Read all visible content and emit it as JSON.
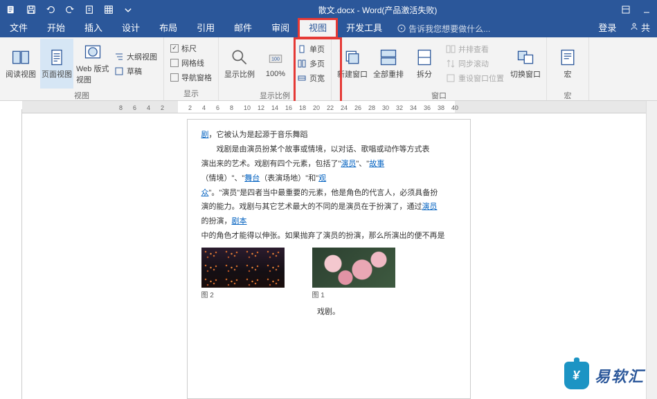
{
  "title": {
    "filename": "散文.docx",
    "app": "Word",
    "status": "(产品激活失败)"
  },
  "qat": {
    "save": "save",
    "undo": "undo",
    "redo": "redo",
    "new": "new-file",
    "table": "table"
  },
  "tabs": {
    "file": "文件",
    "home": "开始",
    "insert": "插入",
    "design": "设计",
    "layout": "布局",
    "references": "引用",
    "mailings": "邮件",
    "review": "审阅",
    "view": "视图",
    "developer": "开发工具",
    "tellme_placeholder": "告诉我您想要做什么...",
    "login": "登录",
    "share": "共"
  },
  "ribbon": {
    "views": {
      "label": "视图",
      "read": "阅读视图",
      "print": "页面视图",
      "web": "Web 版式视图",
      "outline": "大纲视图",
      "draft": "草稿"
    },
    "show": {
      "label": "显示",
      "ruler": "标尺",
      "gridlines": "网格线",
      "navpane": "导航窗格",
      "ruler_checked": true,
      "gridlines_checked": false,
      "navpane_checked": false
    },
    "zoom": {
      "label": "显示比例",
      "zoom": "显示比例",
      "hundred": "100%",
      "onepage": "单页",
      "multipage": "多页",
      "pagewidth": "页宽"
    },
    "window": {
      "label": "窗口",
      "newwin": "新建窗口",
      "arrange": "全部重排",
      "split": "拆分",
      "sidebyside": "并排查看",
      "syncscroll": "同步滚动",
      "resetpos": "重设窗口位置",
      "switchwin": "切换窗口"
    },
    "macros": {
      "label": "宏",
      "macros": "宏"
    }
  },
  "ruler": {
    "marks": [
      "8",
      "6",
      "4",
      "2",
      "2",
      "4",
      "6",
      "8",
      "10",
      "12",
      "14",
      "16",
      "18",
      "20",
      "22",
      "24",
      "26",
      "28",
      "30",
      "32",
      "34",
      "36",
      "38",
      "40"
    ]
  },
  "doc": {
    "l1_a": "剧",
    "l1_b": "，它被认为是起源于音乐舞蹈",
    "l2": "戏剧是由演员扮某个故事或情境，以对话、歌唱或动作等方式表",
    "l3_a": "演出来的艺术。戏剧有四个元素，包括了\"",
    "l3_link1": "演员",
    "l3_b": "\"、\"",
    "l3_link2": "故事",
    "l4_a": "（情境）\"、\"",
    "l4_link1": "舞台",
    "l4_b": "（表演场地）\"和\"",
    "l4_link2": "观",
    "l5_a": "众",
    "l5_b": "\"。\"演员\"是四者当中最重要的元素，他是角色的代言人，必须具备扮",
    "l6_a": "演的能力。戏剧与其它艺术最大的不同的是演员在于扮演了，通过",
    "l6_link": "演员",
    "l7_a": "的扮演，",
    "l7_link": "剧本",
    "l8": "中的角色才能得以伸张。如果抛弃了演员的扮演，那么所演出的便不再是",
    "cap1": "图 2",
    "cap2": "图 1",
    "tail": "戏剧。"
  },
  "watermark": "易软汇"
}
